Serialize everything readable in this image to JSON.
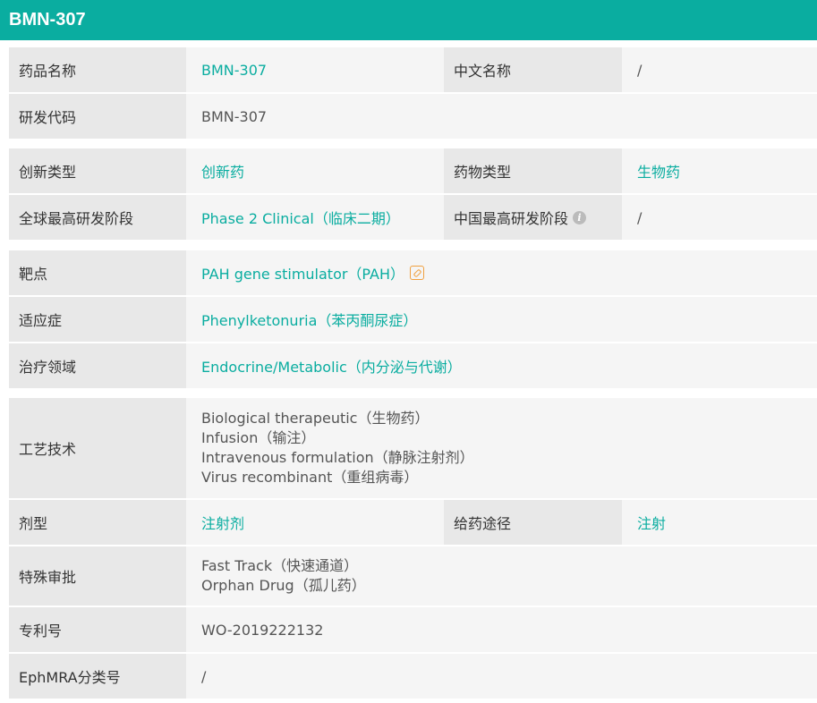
{
  "header": {
    "title": "BMN-307"
  },
  "rows": {
    "drug_name": {
      "label": "药品名称",
      "value": "BMN-307"
    },
    "chinese_name": {
      "label": "中文名称",
      "value": "/"
    },
    "rd_code": {
      "label": "研发代码",
      "value": "BMN-307"
    },
    "innovation_type": {
      "label": "创新类型",
      "value": "创新药"
    },
    "drug_type": {
      "label": "药物类型",
      "value": "生物药"
    },
    "global_stage": {
      "label": "全球最高研发阶段",
      "value": "Phase 2 Clinical（临床二期）"
    },
    "china_stage": {
      "label": "中国最高研发阶段",
      "value": "/"
    },
    "target": {
      "label": "靶点",
      "value": "PAH gene stimulator（PAH）"
    },
    "indication": {
      "label": "适应症",
      "value": "Phenylketonuria（苯丙酮尿症）"
    },
    "therapeutic_area": {
      "label": "治疗领域",
      "value": "Endocrine/Metabolic（内分泌与代谢）"
    },
    "technology": {
      "label": "工艺技术",
      "values": [
        "Biological therapeutic（生物药）",
        "Infusion（输注）",
        "Intravenous formulation（静脉注射剂）",
        "Virus recombinant（重组病毒）"
      ]
    },
    "dosage_form": {
      "label": "剂型",
      "value": "注射剂"
    },
    "route": {
      "label": "给药途径",
      "value": "注射"
    },
    "special_approval": {
      "label": "特殊审批",
      "values": [
        "Fast Track（快速通道）",
        "Orphan Drug（孤儿药）"
      ]
    },
    "patent_no": {
      "label": "专利号",
      "value": "WO-2019222132"
    },
    "ephmra": {
      "label": "EphMRA分类号",
      "value": "/"
    }
  },
  "icons": {
    "info": "info-icon",
    "link": "link-icon"
  },
  "colors": {
    "accent": "#0aada0",
    "link_icon": "#f0a040"
  }
}
